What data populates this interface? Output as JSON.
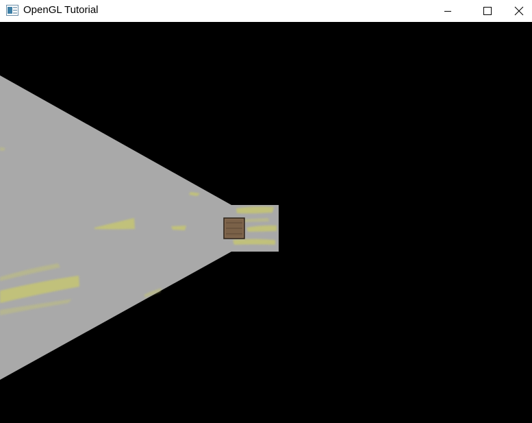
{
  "window": {
    "title": "OpenGL Tutorial",
    "app_icon": "application-icon",
    "controls": {
      "minimize_icon": "minimize-icon",
      "maximize_icon": "maximize-icon",
      "close_icon": "close-icon"
    }
  },
  "scene": {
    "background_color": "#000000",
    "floor_color": "#a9a9a9",
    "floor_stain_color": "#c8c86a",
    "crate_color": "#7a6148"
  }
}
